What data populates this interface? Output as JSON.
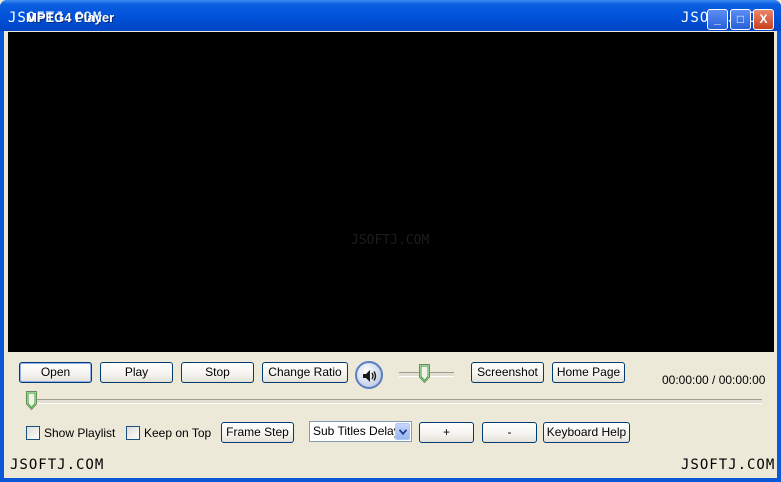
{
  "window": {
    "title": "MPEG4 Player"
  },
  "watermarks": {
    "top_left": "JSOFTJ.COM",
    "top_right": "JSOFTJ.COM",
    "center": "JSOFTJ.COM",
    "bottom_left": "JSOFTJ.COM",
    "bottom_right": "JSOFTJ.COM"
  },
  "titlebar_buttons": {
    "minimize": "_",
    "maximize": "□",
    "close": "X"
  },
  "controls": {
    "open": "Open",
    "play": "Play",
    "stop": "Stop",
    "change_ratio": "Change Ratio",
    "screenshot": "Screenshot",
    "home_page": "Home Page",
    "volume_level": 0.45,
    "time": "00:00:00 / 00:00:00",
    "seek_position": 0.0
  },
  "bottom": {
    "show_playlist": "Show Playlist",
    "keep_on_top": "Keep on Top",
    "frame_step": "Frame Step",
    "subtitles_select": "Sub Titles Delay",
    "plus": "+",
    "minus": "-",
    "keyboard_help": "Keyboard Help"
  },
  "icons": [
    "speaker-icon",
    "dropdown-arrow-icon"
  ],
  "colors": {
    "titlebar": "#0052d9",
    "video_bg": "#000000",
    "client_bg": "#ece9d8"
  }
}
